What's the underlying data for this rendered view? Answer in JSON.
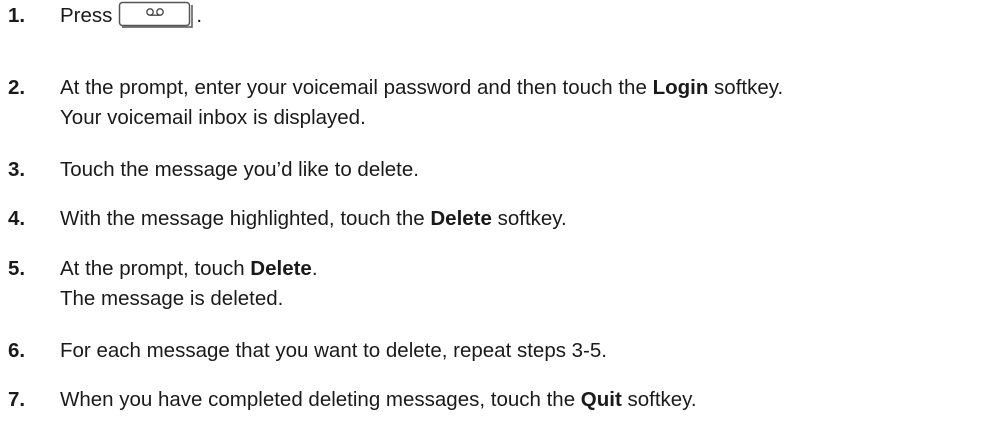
{
  "steps": [
    {
      "number": "1.",
      "lines": [
        {
          "parts": [
            {
              "text": "Press",
              "bold": false
            },
            {
              "icon": "voicemail-key-icon"
            },
            {
              "text": ".",
              "bold": false
            }
          ]
        }
      ]
    },
    {
      "number": "2.",
      "lines": [
        {
          "parts": [
            {
              "text": "At the prompt, enter your voicemail password and then touch the ",
              "bold": false
            },
            {
              "text": "Login",
              "bold": true
            },
            {
              "text": " softkey.",
              "bold": false
            }
          ]
        },
        {
          "parts": [
            {
              "text": "Your voicemail inbox is displayed.",
              "bold": false
            }
          ]
        }
      ]
    },
    {
      "number": "3.",
      "lines": [
        {
          "parts": [
            {
              "text": "Touch the message you’d like to delete.",
              "bold": false
            }
          ]
        }
      ]
    },
    {
      "number": "4.",
      "lines": [
        {
          "parts": [
            {
              "text": "With the message highlighted, touch the ",
              "bold": false
            },
            {
              "text": "Delete",
              "bold": true
            },
            {
              "text": " softkey.",
              "bold": false
            }
          ]
        }
      ]
    },
    {
      "number": "5.",
      "lines": [
        {
          "parts": [
            {
              "text": "At the prompt, touch ",
              "bold": false
            },
            {
              "text": "Delete",
              "bold": true
            },
            {
              "text": ".",
              "bold": false
            }
          ]
        },
        {
          "parts": [
            {
              "text": "The message is deleted.",
              "bold": false
            }
          ]
        }
      ]
    },
    {
      "number": "6.",
      "lines": [
        {
          "parts": [
            {
              "text": "For each message that you want to delete, repeat steps 3-5.",
              "bold": false
            }
          ]
        }
      ]
    },
    {
      "number": "7.",
      "lines": [
        {
          "parts": [
            {
              "text": "When you have completed deleting messages, touch the ",
              "bold": false
            },
            {
              "text": "Quit",
              "bold": true
            },
            {
              "text": " softkey.",
              "bold": false
            }
          ]
        }
      ]
    }
  ]
}
